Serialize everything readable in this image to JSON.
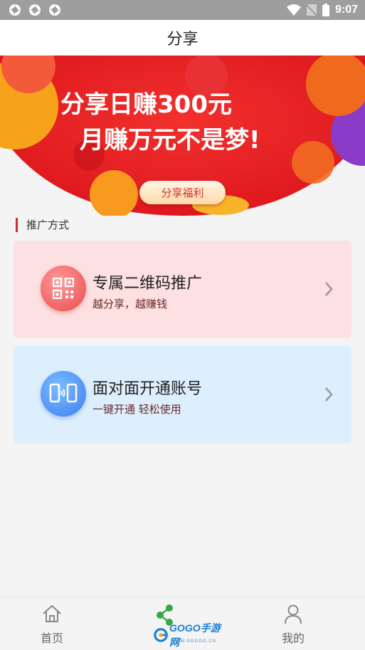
{
  "status_bar": {
    "time": "9:07"
  },
  "header": {
    "title": "分享"
  },
  "banner": {
    "headline_line1": "分享日赚300元",
    "headline_line2": "月赚万元不是梦!",
    "button_label": "分享福利"
  },
  "section": {
    "title": "推广方式"
  },
  "cards": [
    {
      "title": "专属二维码推广",
      "subtitle": "越分享，越赚钱"
    },
    {
      "title": "面对面开通账号",
      "subtitle": "一键开通  轻松使用"
    }
  ],
  "bottom_nav": {
    "items": [
      {
        "label": "首页"
      },
      {
        "label": "分享"
      },
      {
        "label": "我的"
      }
    ]
  },
  "watermark": {
    "text": "GOGO手游网",
    "sub": "WWW.GOGOO.CN"
  },
  "colors": {
    "accent_red": "#e21e26",
    "share_green": "#3aa64a"
  }
}
